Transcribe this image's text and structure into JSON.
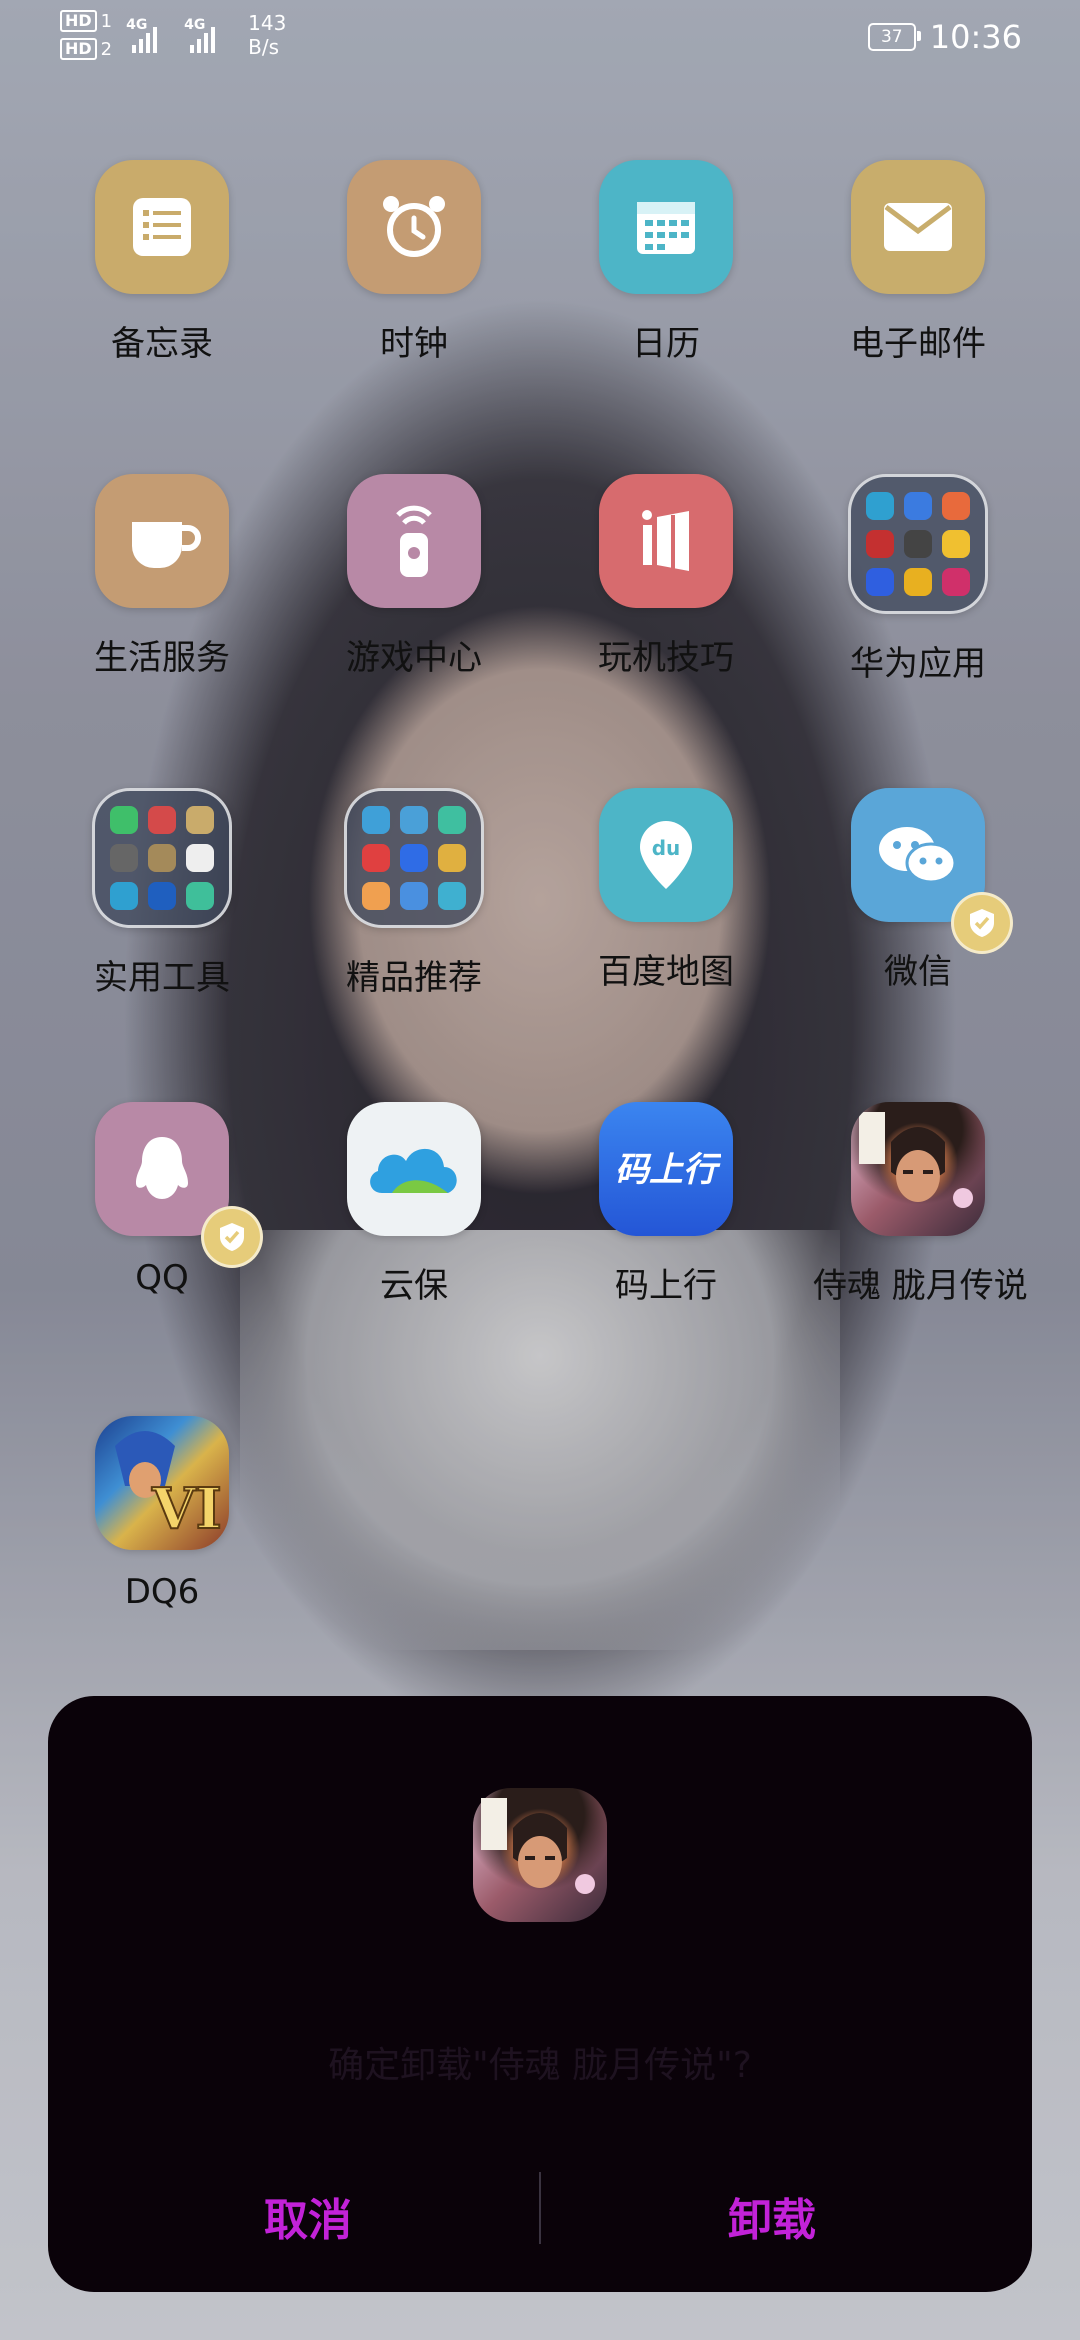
{
  "status_bar": {
    "hd1": "HD",
    "hd1_sub": "1",
    "hd2": "HD",
    "hd2_sub": "2",
    "net1": "4G",
    "net2": "4G",
    "speed_value": "143",
    "speed_unit": "B/s",
    "battery": "37",
    "time": "10:36"
  },
  "apps": [
    {
      "label": "备忘录",
      "icon": "notes-icon",
      "color": "#c9ab6b"
    },
    {
      "label": "时钟",
      "icon": "alarm-clock-icon",
      "color": "#c49c73"
    },
    {
      "label": "日历",
      "icon": "calendar-icon",
      "color": "#4db5c7"
    },
    {
      "label": "电子邮件",
      "icon": "mail-icon",
      "color": "#c8ad6c"
    },
    {
      "label": "生活服务",
      "icon": "coffee-cup-icon",
      "color": "#c49c73"
    },
    {
      "label": "游戏中心",
      "icon": "remote-icon",
      "color": "#b889a6"
    },
    {
      "label": "玩机技巧",
      "icon": "tips-icon",
      "color": "#d76b6e"
    },
    {
      "label": "华为应用",
      "icon": "folder-icon",
      "color": "#3b465c"
    },
    {
      "label": "实用工具",
      "icon": "folder-icon",
      "color": "#3b465c"
    },
    {
      "label": "精品推荐",
      "icon": "folder-icon",
      "color": "#3b465c"
    },
    {
      "label": "百度地图",
      "icon": "baidu-map-icon",
      "color": "#4db5c7"
    },
    {
      "label": "微信",
      "icon": "wechat-icon",
      "color": "#5aa6d8"
    },
    {
      "label": "QQ",
      "icon": "qq-penguin-icon",
      "color": "#b889a6"
    },
    {
      "label": "云保",
      "icon": "cloud-icon",
      "color": "#eef2f4"
    },
    {
      "label": "码上行",
      "icon": "code-qr-icon",
      "color": "#2f6ce6"
    },
    {
      "label": "侍魂 胧月传说",
      "icon": "game-samurai-icon",
      "color": "#7a4a55"
    },
    {
      "label": "DQ6",
      "icon": "game-dq6-icon",
      "color": "#2f6ce6"
    }
  ],
  "dialog": {
    "message": "确定卸载\"侍魂 胧月传说\"?",
    "cancel": "取消",
    "uninstall": "卸载"
  }
}
